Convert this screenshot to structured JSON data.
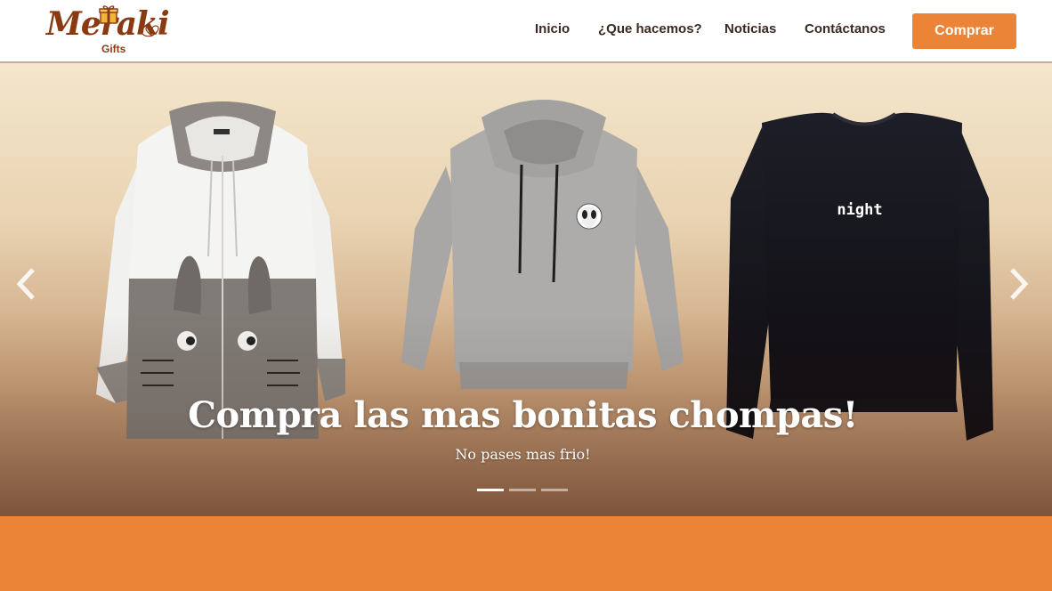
{
  "logo": {
    "word": "Meraki",
    "sub": "Gifts",
    "brand_color": "#8a3a12"
  },
  "nav": {
    "items": [
      {
        "label": "Inicio"
      },
      {
        "label": "¿Que hacemos?"
      },
      {
        "label": "Noticias"
      },
      {
        "label": "Contáctanos"
      }
    ],
    "cta_label": "Comprar",
    "cta_color": "#ec8437"
  },
  "carousel": {
    "title": "Compra las mas bonitas chompas!",
    "subtitle": "No pases mas frio!",
    "prev_icon": "chevron-left-icon",
    "next_icon": "chevron-right-icon",
    "slide_count": 3,
    "active_index": 0,
    "products": [
      {
        "name": "totoro-zip-hoodie"
      },
      {
        "name": "grey-alien-hoodie",
        "patch_icon": "alien-icon"
      },
      {
        "name": "black-night-sweater",
        "print_text": "night",
        "cuff_icon": "moon-icon"
      }
    ]
  },
  "colors": {
    "accent": "#ec8437",
    "nav_text": "#3b2a22"
  }
}
